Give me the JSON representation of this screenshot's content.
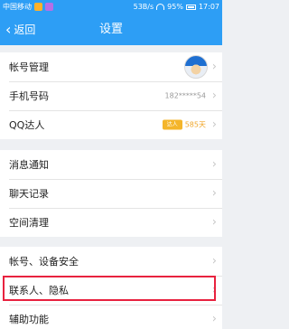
{
  "status_bar": {
    "carrier": "中国移动",
    "speed": "53B/s",
    "battery": "95%",
    "time": "17:07"
  },
  "header": {
    "back_label": "返回",
    "title": "设置"
  },
  "groups": [
    {
      "items": [
        {
          "label": "帐号管理",
          "type": "avatar"
        },
        {
          "label": "手机号码",
          "value": "182*****54"
        },
        {
          "label": "QQ达人",
          "badge": "达人",
          "badge_value": "585天"
        }
      ]
    },
    {
      "items": [
        {
          "label": "消息通知"
        },
        {
          "label": "聊天记录"
        },
        {
          "label": "空间清理"
        }
      ]
    },
    {
      "items": [
        {
          "label": "帐号、设备安全"
        },
        {
          "label": "联系人、隐私"
        },
        {
          "label": "辅助功能"
        }
      ]
    }
  ],
  "colors": {
    "accent": "#2d9ef5",
    "highlight": "#e8223f",
    "badge": "#f4b52a"
  }
}
